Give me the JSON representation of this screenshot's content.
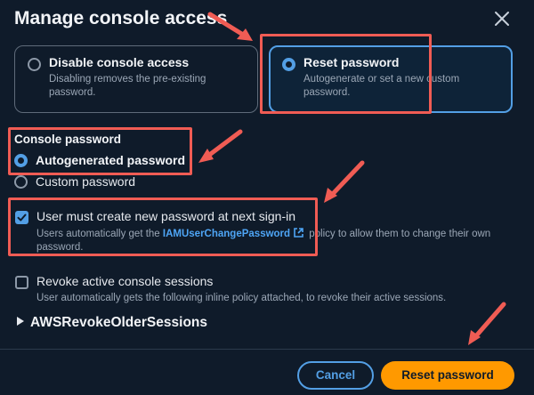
{
  "dialog": {
    "title": "Manage console access",
    "close_icon": "close-icon"
  },
  "access_options": [
    {
      "label": "Disable console access",
      "description": "Disabling removes the pre-existing password.",
      "selected": false
    },
    {
      "label": "Reset password",
      "description": "Autogenerate or set a new custom password.",
      "selected": true
    }
  ],
  "console_password": {
    "label": "Console password",
    "options": [
      {
        "label": "Autogenerated password",
        "selected": true
      },
      {
        "label": "Custom password",
        "selected": false
      }
    ]
  },
  "require_reset": {
    "label": "User must create new password at next sign-in",
    "checked": true,
    "desc_before": "Users automatically get the ",
    "link": "IAMUserChangePassword",
    "desc_after": " policy to allow them to change their own password."
  },
  "revoke_sessions": {
    "label": "Revoke active console sessions",
    "checked": false,
    "description": "User automatically gets the following inline policy attached, to revoke their active sessions."
  },
  "expander": {
    "label": "AWSRevokeOlderSessions"
  },
  "footer": {
    "cancel": "Cancel",
    "primary": "Reset password"
  },
  "colors": {
    "accent": "#539fe5",
    "primary_button": "#ff9900",
    "annotation": "#f05c54",
    "background": "#0f1b2a"
  }
}
